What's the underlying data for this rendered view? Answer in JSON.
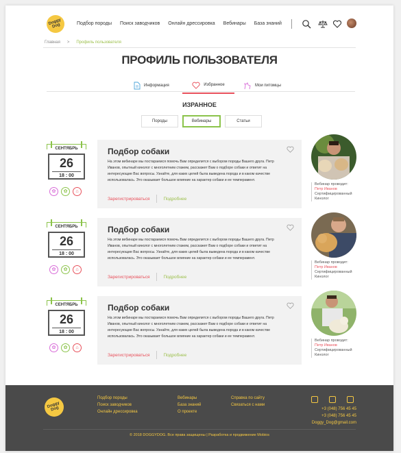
{
  "header": {
    "logo_text": "Doggy Dog",
    "nav": [
      "Подбор породы",
      "Поиск заводчиков",
      "Онлайн дрессировка",
      "Вебинары",
      "База знаний"
    ],
    "icons": [
      "search-icon",
      "scales-icon",
      "heart-icon",
      "user-avatar"
    ]
  },
  "breadcrumb": {
    "home": "Главная",
    "separator": ">",
    "current": "Профиль пользователя"
  },
  "page_title": "ПРОФИЛЬ ПОЛЬЗОВАТЕЛЯ",
  "profile_tabs": [
    {
      "label": "Информация",
      "icon": "document-icon",
      "active": false
    },
    {
      "label": "Избранное",
      "icon": "heart-icon",
      "active": true
    },
    {
      "label": "Мои питомцы",
      "icon": "dog-icon",
      "active": false
    }
  ],
  "section_title": "ИЗРАННОЕ",
  "filter_tabs": [
    {
      "label": "Породы",
      "active": false
    },
    {
      "label": "Вебинары",
      "active": true
    },
    {
      "label": "Статьи",
      "active": false
    }
  ],
  "webinars": [
    {
      "month": "СЕНТЯБРЬ",
      "day": "26",
      "time": "18 : 00",
      "title": "Подбор собаки",
      "text": "На этом вебинаре мы постараемся помочь Вам определится с выбором породы Вашего друга. Петр Иванов, опытный кинолог с многолетним стажем, расскажет Вам о подборе собаки и ответит на интересующие Вас вопросы. Узнайте, для каких целей была выведена порода и в каком качестве использовалась. Это оказывает большое влияние на характер собаки и ее темперамент.",
      "register": "Зарегистрироваться",
      "more": "Подробнее",
      "speaker_label": "Вебинар проводит:",
      "speaker_name": "Петр Иванов",
      "speaker_role": "Сертифицированный Кинолог"
    },
    {
      "month": "СЕНТЯБРЬ",
      "day": "26",
      "time": "18 : 00",
      "title": "Подбор собаки",
      "text": "На этом вебинаре мы постараемся помочь Вам определится с выбором породы Вашего друга. Петр Иванов, опытный кинолог с многолетним стажем, расскажет Вам о подборе собаки и ответит на интересующие Вас вопросы. Узнайте, для каких целей была выведена порода и в каком качестве использовалась. Это оказывает большое влияние на характер собаки и ее темперамент.",
      "register": "Зарегистрироваться",
      "more": "Подробнее",
      "speaker_label": "Вебинар проводит:",
      "speaker_name": "Петр Иванов",
      "speaker_role": "Сертифицированный Кинолог"
    },
    {
      "month": "СЕНТЯБРЬ",
      "day": "26",
      "time": "18 : 00",
      "title": "Подбор собаки",
      "text": "На этом вебинаре мы постараемся помочь Вам определится с выбором породы Вашего друга. Петр Иванов, опытный кинолог с многолетним стажем, расскажет Вам о подборе собаки и ответит на интересующие Вас вопросы. Узнайте, для каких целей была выведена порода и в каком качестве использовалась. Это оказывает большое влияние на характер собаки и ее темперамент.",
      "register": "Зарегистрироваться",
      "more": "Подробнее",
      "speaker_label": "Вебинар проводит:",
      "speaker_name": "Петр Иванов",
      "speaker_role": "Сертифицированный Кинолог"
    }
  ],
  "footer": {
    "logo_text": "Doggy Dog",
    "col1": [
      "Подбор породы",
      "Поиск заводчиков",
      "Онлайн дрессировка"
    ],
    "col2": [
      "Вебинары",
      "База знаний",
      "О проекте"
    ],
    "col3": [
      "Справка по сайту",
      "Связаться с нами"
    ],
    "social": [
      "blog-icon",
      "instagram-icon",
      "share-icon"
    ],
    "phone1": "+3 (048) 756 45 45",
    "phone2": "+3 (048) 756 45 45",
    "email": "Doggy_Dog@gmail.com",
    "copyright": "© 2018 DOGGYDOG. Все права защищены | Разработка и продвижение Mobios"
  },
  "colors": {
    "accent_red": "#e8505b",
    "accent_green": "#8bc34a",
    "footer_bg": "#4a4a4a",
    "footer_text": "#f5c842"
  }
}
